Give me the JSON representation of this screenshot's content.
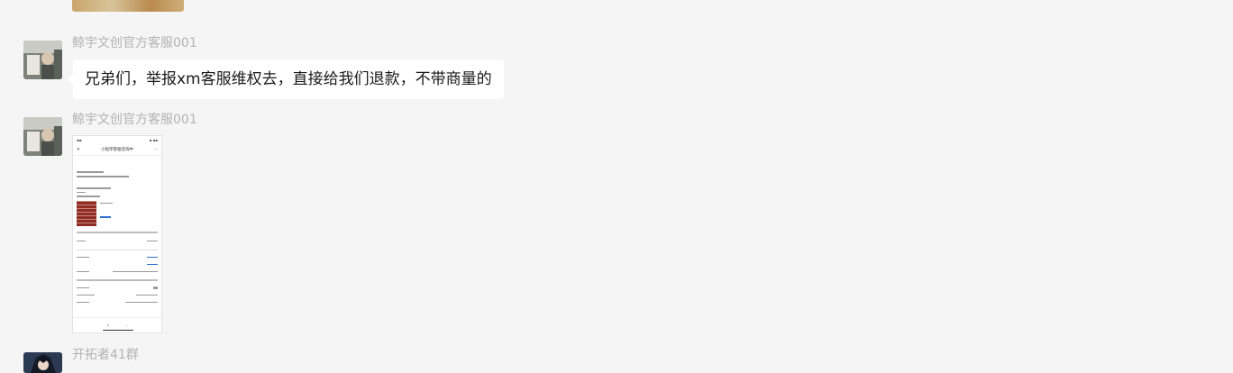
{
  "messages": [
    {
      "sender": "鲸宇文创官方客服001",
      "text": "兄弟们，举报xm客服维权去，直接给我们退款，不带商量的"
    },
    {
      "sender": "鲸宇文创官方客服001",
      "image": "phone-screenshot"
    },
    {
      "sender": "开拓者41群"
    }
  ],
  "phone_shot": {
    "nav_title": "小程序客服咨询中"
  },
  "colors": {
    "background": "#f5f5f5",
    "bubble": "#ffffff",
    "sender_text": "#b2b2b2",
    "message_text": "#1a1a1a"
  }
}
